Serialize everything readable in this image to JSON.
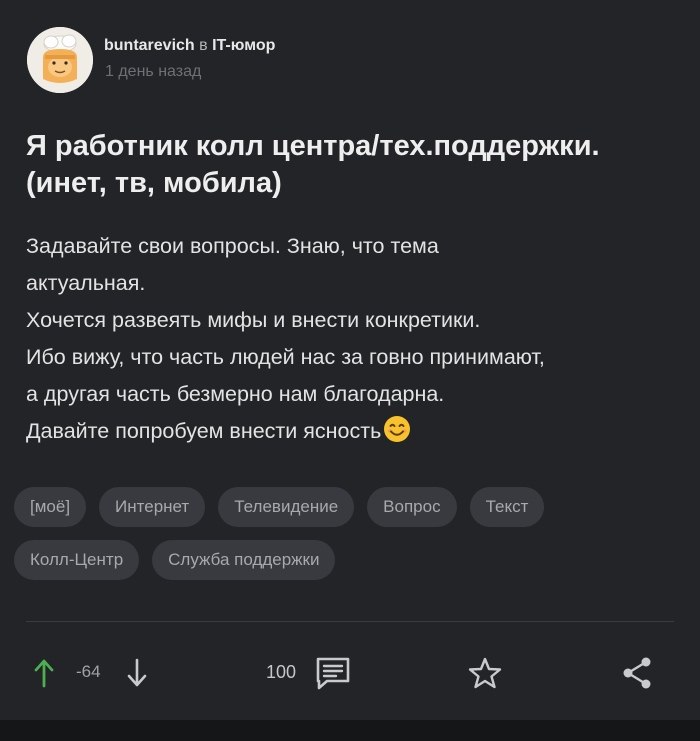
{
  "post": {
    "author": "buntarevich",
    "in_word": "в",
    "community": "IT-юмор",
    "time": "1 день назад",
    "title_lines": [
      "Я работник колл центра/тех.поддержки.",
      "(инет, тв, мобила)"
    ],
    "body_lines": [
      "Задавайте свои вопросы. Знаю, что тема",
      "актуальная.",
      "Хочется развеять мифы и внести конкретики.",
      "Ибо вижу, что часть людей нас за говно принимают,",
      "а другая часть безмерно нам благодарна.",
      "Давайте попробуем внести ясность"
    ],
    "tags_row1": [
      "[моё]",
      "Интернет",
      "Телевидение",
      "Вопрос",
      "Текст"
    ],
    "tags_row2": [
      "Колл-Центр",
      "Служба поддержки"
    ]
  },
  "actions": {
    "rating": "-64",
    "comments_count": "100"
  },
  "icons": {
    "upvote": "arrow-up-icon",
    "downvote": "arrow-down-icon",
    "comments": "comment-icon",
    "save": "star-icon",
    "share": "share-icon",
    "emoji": "smiling-face-emoji"
  },
  "colors": {
    "background": "#222427",
    "upvote": "#4caf50",
    "icon": "#c8cacd",
    "tag_bg": "#383a3f",
    "emoji": "#f7c22b"
  }
}
